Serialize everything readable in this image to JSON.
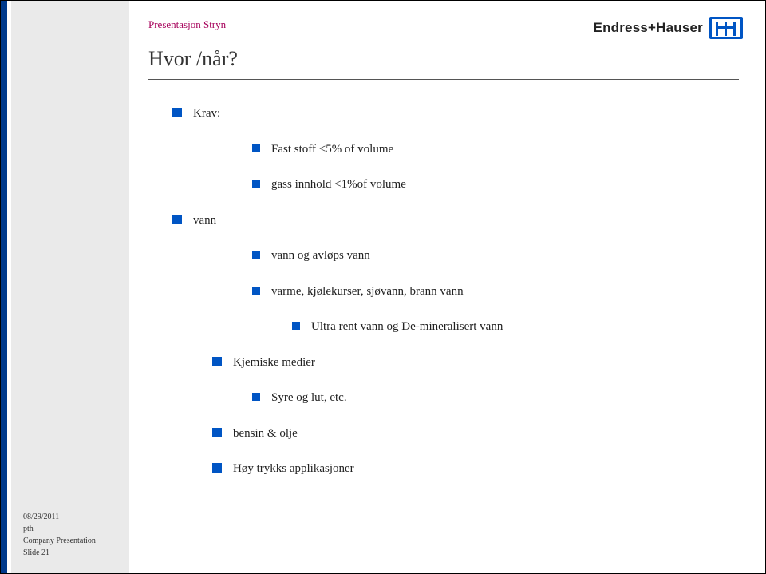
{
  "header": {
    "presentation_label": "Presentasjon Stryn",
    "title": "Hvor /når?",
    "logo_text": "Endress+Hauser"
  },
  "content": {
    "krav_label": "Krav:",
    "krav_sub1": "Fast stoff <5% of volume",
    "krav_sub2": "gass innhold <1%of volume",
    "vann_label": "vann",
    "vann_sub1": "vann og avløps vann",
    "vann_sub2": "varme, kjølekurser, sjøvann, brann vann",
    "vann_sub3": "Ultra rent vann og  De-mineralisert vann",
    "kjemiske_label": "Kjemiske medier",
    "kjemiske_sub1": "Syre og lut, etc.",
    "bensin_label": "bensin & olje",
    "hoytrykk_label": "Høy trykks applikasjoner"
  },
  "footer": {
    "date": "08/29/2011",
    "author": "pth",
    "source": "Company Presentation",
    "slide": "Slide 21"
  }
}
